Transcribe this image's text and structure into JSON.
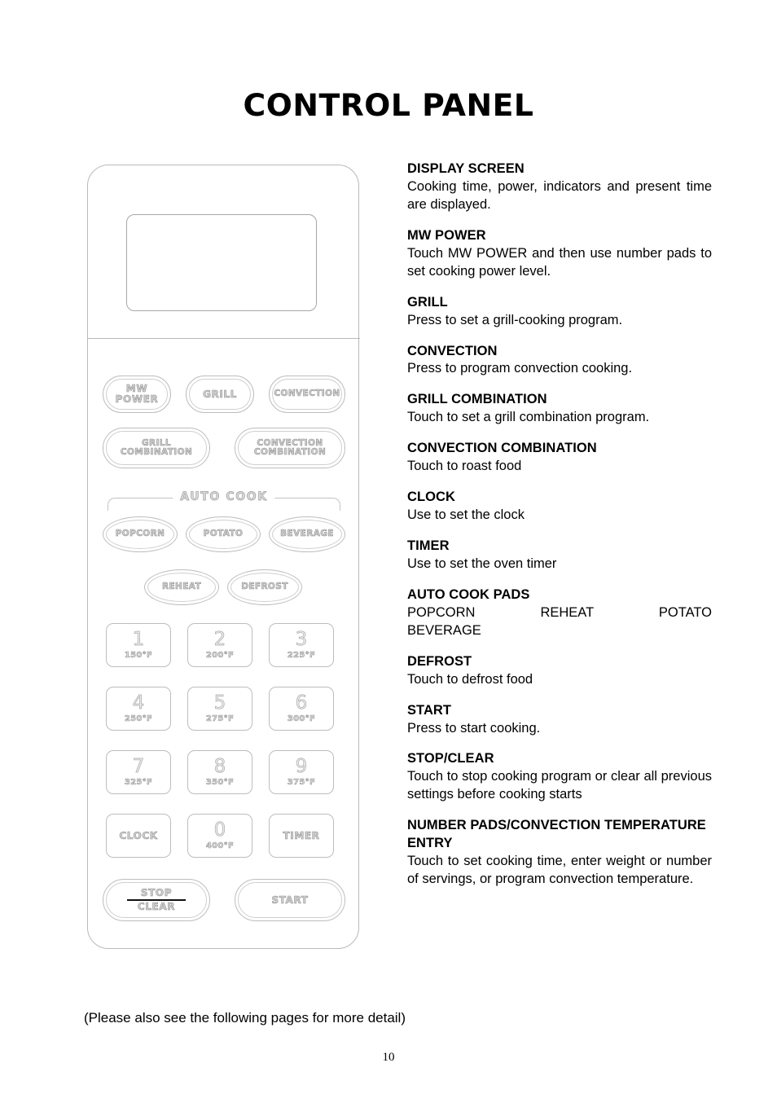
{
  "title": "CONTROL PANEL",
  "panel": {
    "display_screen": "",
    "buttons": {
      "mw_power": "MW\nPOWER",
      "grill": "GRILL",
      "convection": "CONVECTION",
      "grill_combination": "GRILL\nCOMBINATION",
      "convection_combination": "CONVECTION\nCOMBINATION",
      "popcorn": "POPCORN",
      "potato": "POTATO",
      "beverage": "BEVERAGE",
      "reheat": "REHEAT",
      "defrost": "DEFROST",
      "clock": "CLOCK",
      "timer": "TIMER",
      "stop": "STOP",
      "clear": "CLEAR",
      "start": "START"
    },
    "auto_cook_label": "AUTO COOK",
    "keypad": [
      {
        "digit": "1",
        "temp": "150°F"
      },
      {
        "digit": "2",
        "temp": "200°F"
      },
      {
        "digit": "3",
        "temp": "225°F"
      },
      {
        "digit": "4",
        "temp": "250°F"
      },
      {
        "digit": "5",
        "temp": "275°F"
      },
      {
        "digit": "6",
        "temp": "300°F"
      },
      {
        "digit": "7",
        "temp": "325°F"
      },
      {
        "digit": "8",
        "temp": "350°F"
      },
      {
        "digit": "9",
        "temp": "375°F"
      },
      {
        "digit": "0",
        "temp": "400°F"
      }
    ]
  },
  "descriptions": [
    {
      "heading": "DISPLAY SCREEN",
      "body": "Cooking time, power, indicators and present time are displayed."
    },
    {
      "heading": "MW POWER",
      "body": "Touch MW POWER and then use number pads to set cooking power level."
    },
    {
      "heading": "GRILL",
      "body": "Press to set a grill-cooking program."
    },
    {
      "heading": "CONVECTION",
      "body": "Press to program convection cooking."
    },
    {
      "heading": "GRILL COMBINATION",
      "body": "Touch to set a grill combination program."
    },
    {
      "heading": "CONVECTION COMBINATION",
      "body": "Touch to roast food"
    },
    {
      "heading": "CLOCK",
      "body": "Use to set the clock"
    },
    {
      "heading": "TIMER",
      "body": "Use to set the oven timer"
    },
    {
      "heading": "AUTO COOK PADS",
      "body": "POPCORN REHEAT POTATO",
      "body2": "BEVERAGE"
    },
    {
      "heading": "DEFROST",
      "body": "Touch to defrost food"
    },
    {
      "heading": "START",
      "body": "Press to start cooking."
    },
    {
      "heading": "STOP/CLEAR",
      "body": "Touch to stop cooking program or clear all previous settings before cooking starts"
    },
    {
      "heading": "NUMBER PADS/CONVECTION TEMPERATURE ENTRY",
      "body": "Touch to set cooking time, enter weight or number of servings, or program convection temperature."
    }
  ],
  "footnote": "(Please also see the following pages for more detail)",
  "page_number": "10"
}
